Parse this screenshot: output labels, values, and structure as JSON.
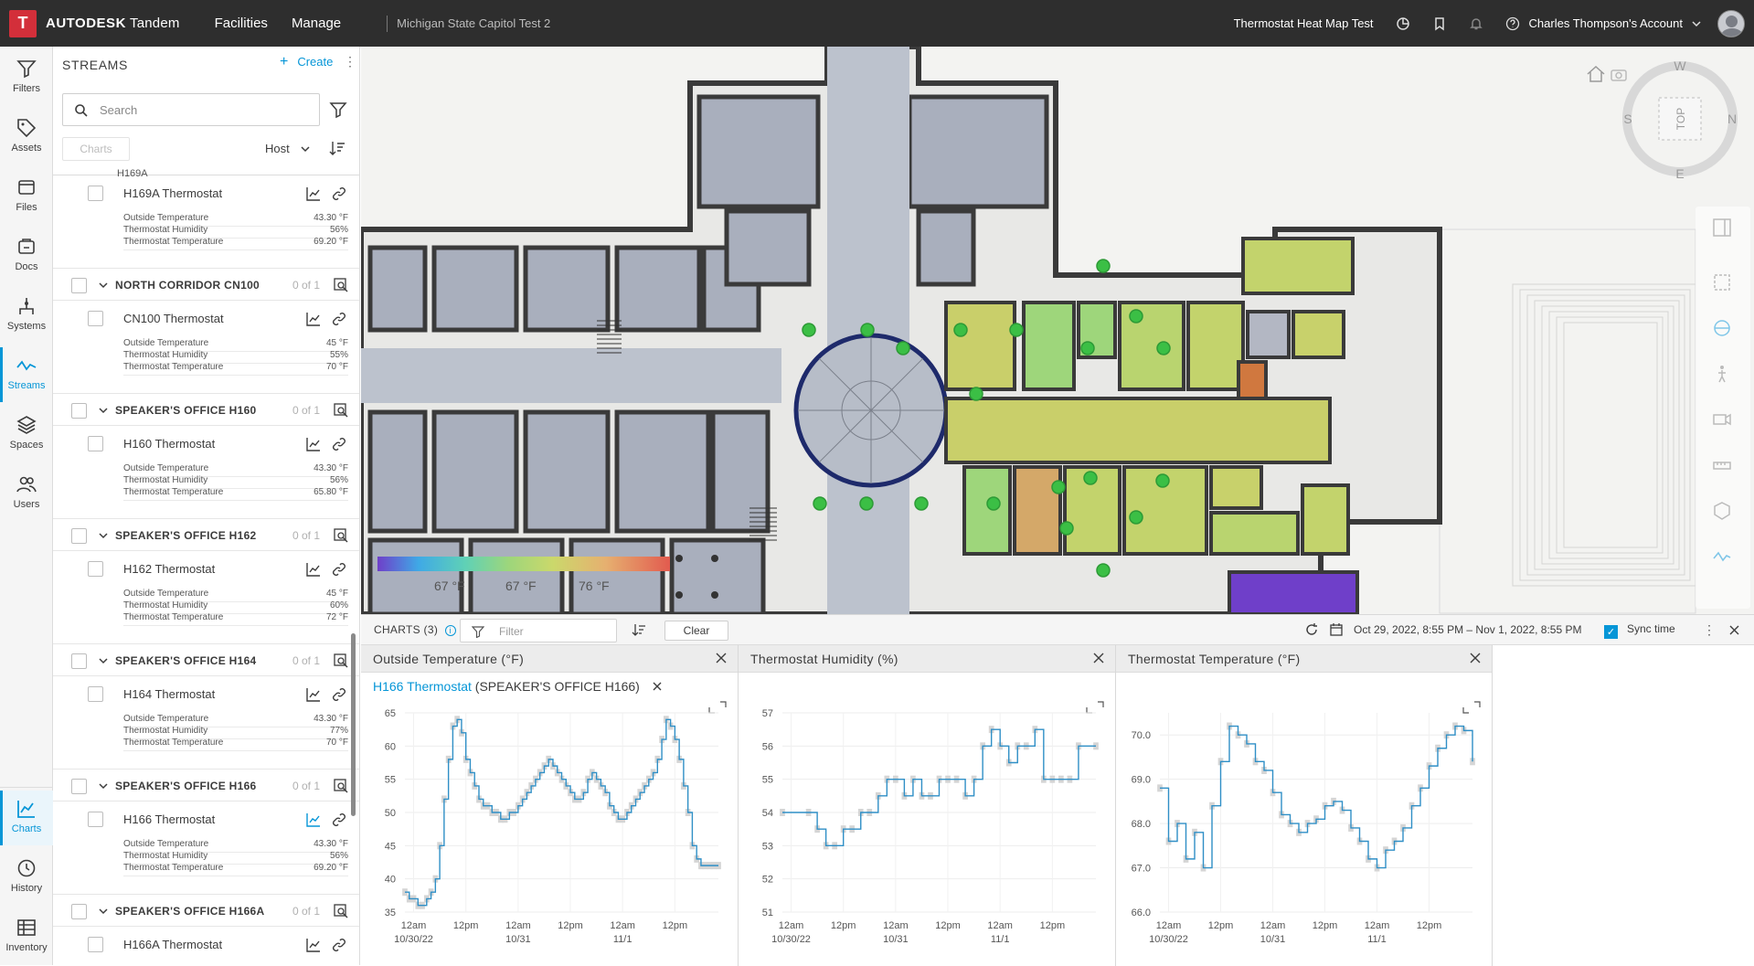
{
  "topbar": {
    "logo_letter": "T",
    "brand_bold": "AUTODESK",
    "brand_rest": " Tandem",
    "nav": [
      "Facilities",
      "Manage"
    ],
    "project": "Michigan State Capitol Test 2",
    "view_name": "Thermostat Heat Map Test",
    "account": "Charles Thompson's Account"
  },
  "rail": {
    "items": [
      "Filters",
      "Assets",
      "Files",
      "Docs",
      "Systems",
      "Streams",
      "Spaces",
      "Users"
    ],
    "bottom_items": [
      "Charts",
      "History",
      "Inventory"
    ]
  },
  "streams_panel": {
    "title": "STREAMS",
    "create_label": "Create",
    "search_placeholder": "Search",
    "charts_button": "Charts",
    "group_by": "Host",
    "clipped_group": "H169A",
    "entries": [
      {
        "group": "",
        "count": "",
        "device": "H169A Thermostat",
        "outside": "43.30 °F",
        "humidity": "56%",
        "temperature": "69.20 °F"
      },
      {
        "group": "NORTH CORRIDOR CN100",
        "count": "0 of 1",
        "device": "CN100 Thermostat",
        "outside": "45 °F",
        "humidity": "55%",
        "temperature": "70 °F"
      },
      {
        "group": "SPEAKER'S OFFICE H160",
        "count": "0 of 1",
        "device": "H160 Thermostat",
        "outside": "43.30 °F",
        "humidity": "56%",
        "temperature": "65.80 °F"
      },
      {
        "group": "SPEAKER'S OFFICE H162",
        "count": "0 of 1",
        "device": "H162 Thermostat",
        "outside": "45 °F",
        "humidity": "60%",
        "temperature": "72 °F"
      },
      {
        "group": "SPEAKER'S OFFICE H164",
        "count": "0 of 1",
        "device": "H164 Thermostat",
        "outside": "43.30 °F",
        "humidity": "77%",
        "temperature": "70 °F"
      },
      {
        "group": "SPEAKER'S OFFICE H166",
        "count": "0 of 1",
        "device": "H166 Thermostat",
        "outside": "43.30 °F",
        "humidity": "56%",
        "temperature": "69.20 °F"
      },
      {
        "group": "SPEAKER'S OFFICE H166A",
        "count": "0 of 1",
        "device": "H166A Thermostat",
        "outside": "",
        "humidity": "",
        "temperature": ""
      }
    ],
    "property_labels": [
      "Outside Temperature",
      "Thermostat Humidity",
      "Thermostat Temperature"
    ]
  },
  "map": {
    "legend_labels": [
      "67 °F",
      "67 °F",
      "76 °F"
    ],
    "compass": {
      "top": "TOP",
      "n": "N",
      "s": "S",
      "e": "E",
      "w": "W"
    }
  },
  "charts_panel": {
    "label": "CHARTS (3)",
    "filter_placeholder": "Filter",
    "clear_label": "Clear",
    "date_range": "Oct 29, 2022, 8:55 PM – Nov 1, 2022, 8:55 PM",
    "sync_label": "Sync time",
    "device_label": "H166 Thermostat",
    "device_context": " (SPEAKER'S OFFICE H166)"
  },
  "chart_data": [
    {
      "type": "line",
      "title": "Outside Temperature (°F)",
      "ylim": [
        35,
        65
      ],
      "yticks": [
        35,
        40,
        45,
        50,
        55,
        60,
        65
      ],
      "xticks": [
        "12am 10/30/22",
        "12pm",
        "12am 10/31",
        "12pm",
        "12am 11/1",
        "12pm"
      ],
      "x": [
        0,
        1,
        2,
        3,
        4,
        5,
        6,
        7,
        8,
        9,
        10,
        11,
        12,
        13,
        14,
        15,
        16,
        17,
        18,
        19,
        20,
        21,
        22,
        23,
        24,
        25,
        26,
        27,
        28,
        29,
        30,
        31,
        32,
        33,
        34,
        35,
        36,
        37,
        38,
        39,
        40,
        41,
        42,
        43,
        44,
        45,
        46,
        47,
        48,
        49,
        50,
        51,
        52,
        53,
        54,
        55,
        56,
        57,
        58,
        59,
        60,
        61,
        62,
        63,
        64,
        65,
        66,
        67,
        68,
        69,
        70,
        71,
        72
      ],
      "values": [
        38,
        37,
        37,
        36,
        36,
        37,
        38,
        40,
        45,
        52,
        58,
        63,
        64,
        62,
        58,
        56,
        54,
        52,
        51,
        51,
        50,
        50,
        49,
        49,
        50,
        50,
        51,
        52,
        53,
        54,
        55,
        56,
        57,
        58,
        57,
        56,
        55,
        54,
        53,
        52,
        52,
        53,
        55,
        56,
        55,
        54,
        53,
        51,
        50,
        49,
        49,
        50,
        51,
        52,
        53,
        54,
        55,
        56,
        58,
        61,
        64,
        63,
        61,
        58,
        54,
        50,
        45,
        43,
        42,
        42,
        42,
        42,
        42
      ]
    },
    {
      "type": "line",
      "title": "Thermostat Humidity (%)",
      "ylim": [
        51,
        57
      ],
      "yticks": [
        51,
        52,
        53,
        54,
        55,
        56,
        57
      ],
      "xticks": [
        "12am 10/30/22",
        "12pm",
        "12am 10/31",
        "12pm",
        "12am 11/1",
        "12pm"
      ],
      "x": [
        0,
        6,
        8,
        10,
        12,
        14,
        16,
        18,
        20,
        22,
        24,
        26,
        28,
        30,
        32,
        34,
        36,
        38,
        40,
        42,
        44,
        46,
        48,
        50,
        52,
        54,
        56,
        58,
        60,
        62,
        64,
        66,
        68,
        72
      ],
      "values": [
        54,
        54,
        53.5,
        53,
        53,
        53.5,
        53.5,
        54,
        54,
        54.5,
        55,
        55,
        54.5,
        55,
        54.5,
        54.5,
        55,
        55,
        55,
        54.5,
        55,
        56,
        56.5,
        56,
        55.5,
        56,
        56,
        56.5,
        55,
        55,
        55,
        55,
        56,
        56
      ]
    },
    {
      "type": "line",
      "title": "Thermostat Temperature (°F)",
      "ylim": [
        66,
        70.5
      ],
      "yticks": [
        66.0,
        67.0,
        68.0,
        69.0,
        70.0
      ],
      "xticks": [
        "12am 10/30/22",
        "12pm",
        "12am 10/31",
        "12pm",
        "12am 11/1",
        "12pm"
      ],
      "x": [
        0,
        2,
        4,
        6,
        8,
        10,
        12,
        14,
        16,
        18,
        20,
        22,
        24,
        26,
        28,
        30,
        32,
        34,
        36,
        38,
        40,
        42,
        44,
        46,
        48,
        50,
        52,
        54,
        56,
        58,
        60,
        62,
        64,
        66,
        68,
        70,
        72
      ],
      "values": [
        68.8,
        67.6,
        68.0,
        67.2,
        67.8,
        67.0,
        68.4,
        69.4,
        70.2,
        70.0,
        69.8,
        69.4,
        69.2,
        68.7,
        68.2,
        68.0,
        67.8,
        68.0,
        68.1,
        68.4,
        68.5,
        68.3,
        67.9,
        67.6,
        67.2,
        67.0,
        67.4,
        67.6,
        67.9,
        68.4,
        68.8,
        69.3,
        69.7,
        70.0,
        70.2,
        70.1,
        69.4
      ]
    }
  ]
}
